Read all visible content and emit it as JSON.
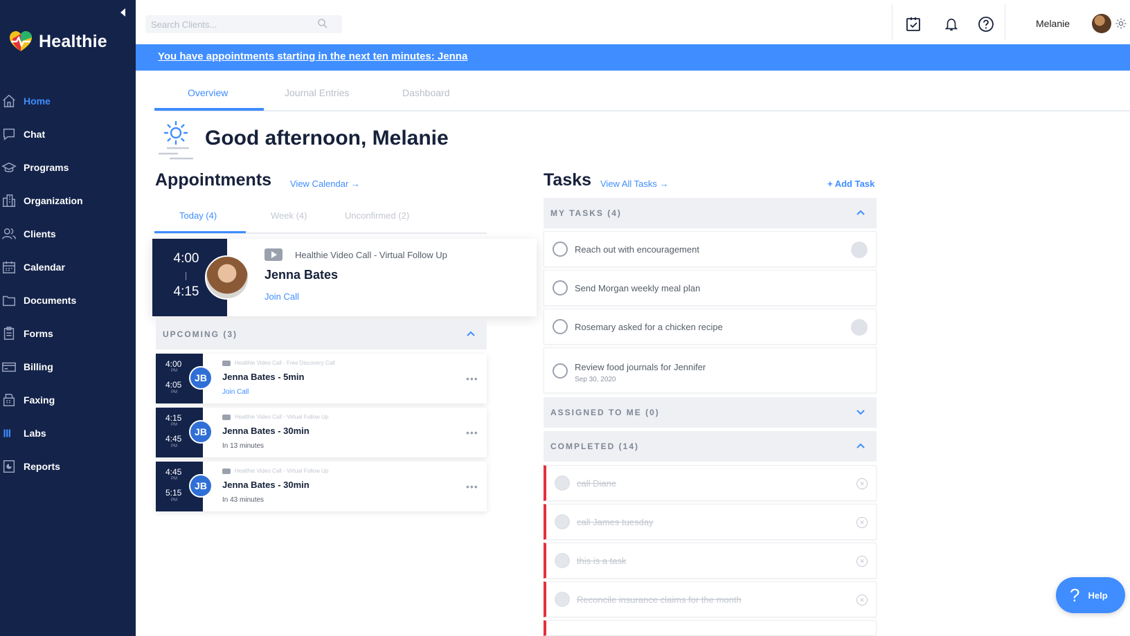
{
  "app": {
    "name": "Healthie"
  },
  "sidebar": {
    "items": [
      {
        "label": "Home",
        "icon": "home-icon",
        "active": true
      },
      {
        "label": "Chat",
        "icon": "chat-icon"
      },
      {
        "label": "Programs",
        "icon": "programs-icon"
      },
      {
        "label": "Organization",
        "icon": "organization-icon"
      },
      {
        "label": "Clients",
        "icon": "clients-icon"
      },
      {
        "label": "Calendar",
        "icon": "calendar-icon"
      },
      {
        "label": "Documents",
        "icon": "documents-icon"
      },
      {
        "label": "Forms",
        "icon": "forms-icon"
      },
      {
        "label": "Billing",
        "icon": "billing-icon"
      },
      {
        "label": "Faxing",
        "icon": "faxing-icon"
      },
      {
        "label": "Labs",
        "icon": "labs-icon"
      },
      {
        "label": "Reports",
        "icon": "reports-icon"
      }
    ]
  },
  "topbar": {
    "search_placeholder": "Search Clients...",
    "user_name": "Melanie"
  },
  "banner": {
    "text": "You have appointments starting in the next ten minutes: Jenna"
  },
  "main_tabs": [
    {
      "label": "Overview",
      "active": true
    },
    {
      "label": "Journal Entries"
    },
    {
      "label": "Dashboard"
    }
  ],
  "greeting": "Good afternoon, Melanie",
  "appointments": {
    "title": "Appointments",
    "view_link": "View Calendar →",
    "tabs": [
      {
        "label": "Today (4)",
        "active": true
      },
      {
        "label": "Week (4)"
      },
      {
        "label": "Unconfirmed (2)"
      }
    ],
    "featured": {
      "start": "4:00",
      "end": "4:15",
      "type": "Healthie Video Call - Virtual Follow Up",
      "name": "Jenna Bates",
      "action": "Join Call"
    },
    "upcoming_header": "UPCOMING (3)",
    "upcoming": [
      {
        "start": "4:00",
        "end": "4:05",
        "ampm": "PM",
        "initials": "JB",
        "type": "Healthie Video Call - Free Discovery Call",
        "name": "Jenna Bates - 5min",
        "sub": "Join Call",
        "sub_is_link": true
      },
      {
        "start": "4:15",
        "end": "4:45",
        "ampm": "PM",
        "initials": "JB",
        "type": "Healthie Video Call - Virtual Follow Up",
        "name": "Jenna Bates - 30min",
        "sub": "In 13 minutes",
        "sub_is_link": false
      },
      {
        "start": "4:45",
        "end": "5:15",
        "ampm": "PM",
        "initials": "JB",
        "type": "Healthie Video Call - Virtual Follow Up",
        "name": "Jenna Bates - 30min",
        "sub": "In 43 minutes",
        "sub_is_link": false
      }
    ]
  },
  "tasks": {
    "title": "Tasks",
    "view_link": "View All Tasks →",
    "add_link": "+ Add Task",
    "my_header": "MY TASKS (4)",
    "my_tasks": [
      {
        "label": "Reach out with encouragement",
        "assignee": true
      },
      {
        "label": "Send Morgan weekly meal plan",
        "assignee": false
      },
      {
        "label": "Rosemary asked for a chicken recipe",
        "assignee": true
      },
      {
        "label": "Review food journals for Jennifer",
        "due": "Sep 30, 2020",
        "assignee": false
      }
    ],
    "assigned_header": "ASSIGNED TO ME (0)",
    "completed_header": "COMPLETED (14)",
    "completed": [
      {
        "label": "call Diane"
      },
      {
        "label": "call James tuesday"
      },
      {
        "label": "this is a task"
      },
      {
        "label": "Reconcile insurance claims for the month"
      }
    ]
  },
  "help": {
    "label": "Help"
  },
  "colors": {
    "sidebar": "#14234a",
    "accent": "#3f8dff",
    "completed_bar": "#e2313b"
  }
}
